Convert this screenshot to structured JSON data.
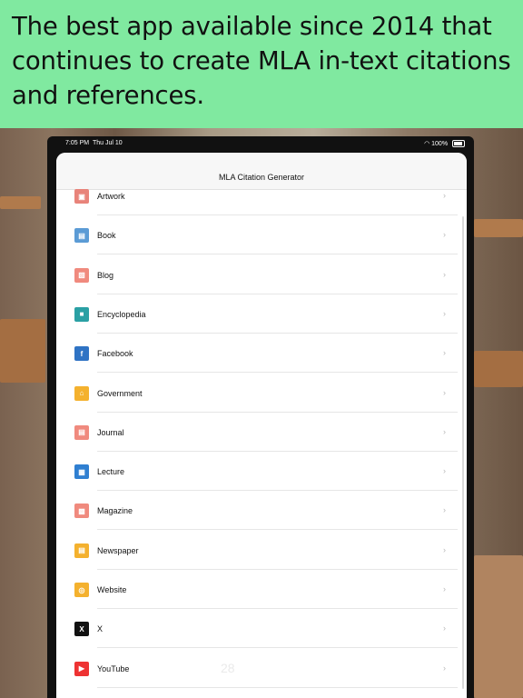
{
  "banner": {
    "headline": "The best app available since 2014 that continues to create MLA in-text citations and references."
  },
  "status_bar": {
    "time": "7:05 PM",
    "date": "Thu Jul 10",
    "battery": "100%"
  },
  "nav": {
    "title": "MLA Citation Generator"
  },
  "page_indicator": "28",
  "items": [
    {
      "label": "Artwork",
      "icon": "artwork-icon",
      "color": "#e8837a"
    },
    {
      "label": "Book",
      "icon": "book-icon",
      "color": "#5b9bd5"
    },
    {
      "label": "Blog",
      "icon": "blog-icon",
      "color": "#f08a7e"
    },
    {
      "label": "Encyclopedia",
      "icon": "encyclopedia-icon",
      "color": "#2aa0a4"
    },
    {
      "label": "Facebook",
      "icon": "facebook-icon",
      "color": "#2f73c4"
    },
    {
      "label": "Government",
      "icon": "government-icon",
      "color": "#f4b12e"
    },
    {
      "label": "Journal",
      "icon": "journal-icon",
      "color": "#f08a7e"
    },
    {
      "label": "Lecture",
      "icon": "lecture-icon",
      "color": "#2f7fd1"
    },
    {
      "label": "Magazine",
      "icon": "magazine-icon",
      "color": "#f08a7e"
    },
    {
      "label": "Newspaper",
      "icon": "newspaper-icon",
      "color": "#f4b12e"
    },
    {
      "label": "Website",
      "icon": "website-icon",
      "color": "#f4b12e"
    },
    {
      "label": "X",
      "icon": "x-logo-icon",
      "color": "#111111"
    },
    {
      "label": "YouTube",
      "icon": "youtube-icon",
      "color": "#2f73c4"
    }
  ]
}
